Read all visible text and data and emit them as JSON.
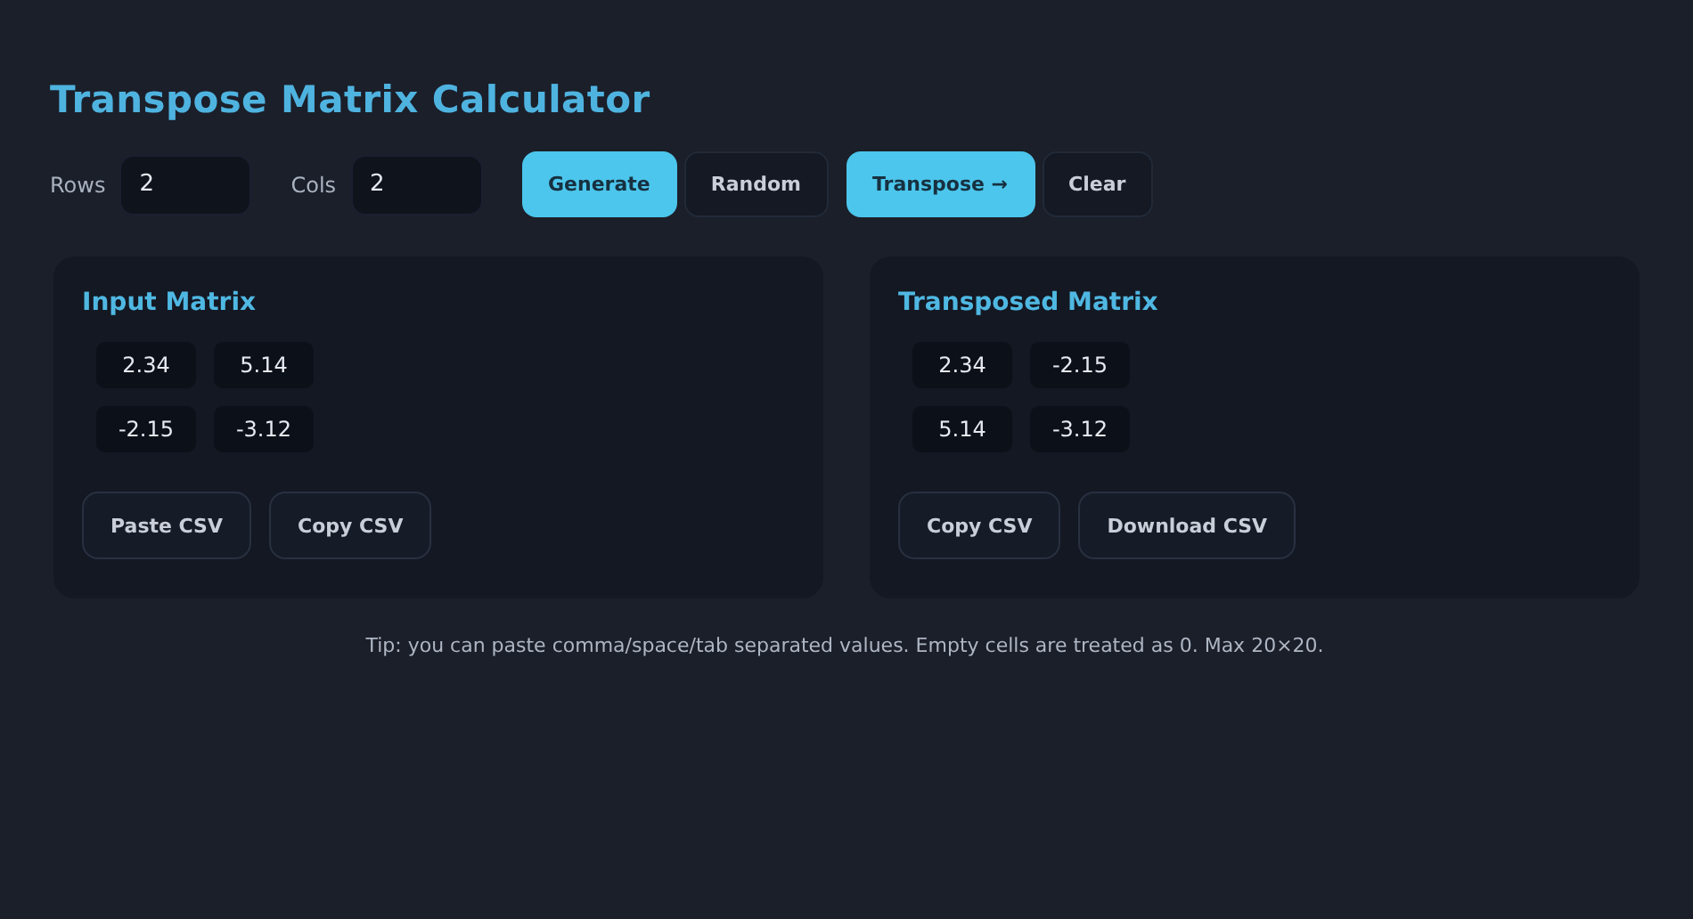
{
  "title": "Transpose Matrix Calculator",
  "controls": {
    "rows": {
      "label": "Rows",
      "value": "2"
    },
    "cols": {
      "label": "Cols",
      "value": "2"
    },
    "buttons": [
      {
        "label": "Generate",
        "kind": "primary"
      },
      {
        "label": "Random",
        "kind": "secondary"
      },
      {
        "label": "Transpose →",
        "kind": "primary"
      },
      {
        "label": "Clear",
        "kind": "secondary"
      }
    ]
  },
  "panels": [
    {
      "title": "Input Matrix",
      "cells": [
        [
          "2.34",
          "5.14"
        ],
        [
          "-2.15",
          "-3.12"
        ]
      ],
      "buttons": [
        "Paste CSV",
        "Copy CSV"
      ]
    },
    {
      "title": "Transposed Matrix",
      "cells": [
        [
          "2.34",
          "-2.15"
        ],
        [
          "5.14",
          "-3.12"
        ]
      ],
      "buttons": [
        "Copy CSV",
        "Download CSV"
      ]
    }
  ],
  "tip": "Tip: you can paste comma/space/tab separated values. Empty cells are treated as 0. Max 20×20."
}
